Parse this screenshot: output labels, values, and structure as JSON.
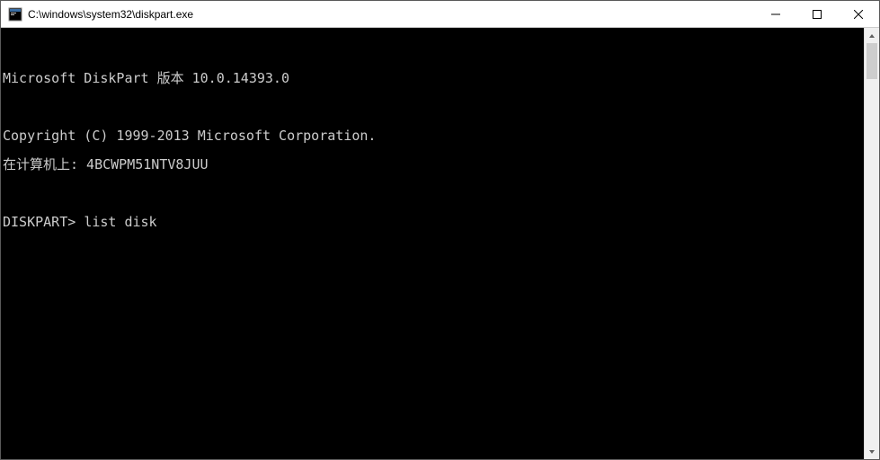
{
  "window": {
    "title": "C:\\windows\\system32\\diskpart.exe"
  },
  "console": {
    "blank0": "",
    "line1": "Microsoft DiskPart 版本 10.0.14393.0",
    "blank1": "",
    "line2": "Copyright (C) 1999-2013 Microsoft Corporation.",
    "line3": "在计算机上: 4BCWPM51NTV8JUU",
    "blank2": "",
    "prompt": "DISKPART> ",
    "input": "list disk"
  }
}
